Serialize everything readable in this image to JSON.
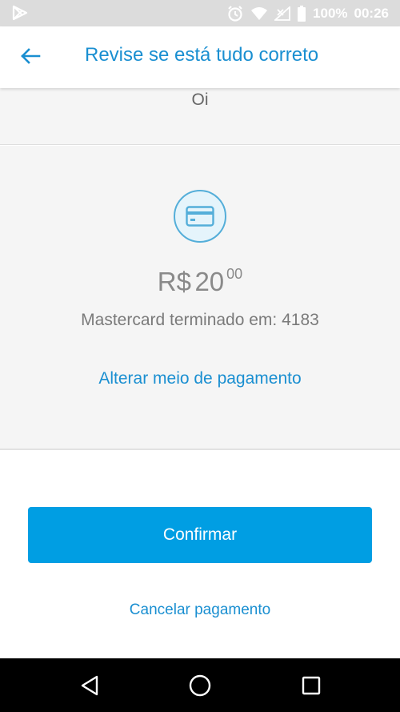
{
  "status_bar": {
    "battery": "100%",
    "time": "00:26",
    "icons": [
      "play-store-icon",
      "alarm-icon",
      "wifi-icon",
      "signal-icon",
      "battery-icon"
    ]
  },
  "app_bar": {
    "title": "Revise se está tudo correto",
    "back_icon": "arrow-left-icon"
  },
  "top_strip": {
    "text": "Oi"
  },
  "payment": {
    "icon": "credit-card-icon",
    "currency": "R$",
    "amount_integer": "20",
    "amount_cents": "00",
    "card_description": "Mastercard terminado em: 4183",
    "change_label": "Alterar meio de pagamento"
  },
  "actions": {
    "confirm_label": "Confirmar",
    "cancel_label": "Cancelar pagamento"
  },
  "nav_bar": {
    "icons": [
      "back-triangle-icon",
      "home-circle-icon",
      "recents-square-icon"
    ]
  },
  "colors": {
    "accent": "#1a8fd1",
    "button": "#009ee3",
    "background_gray": "#f5f5f5"
  }
}
